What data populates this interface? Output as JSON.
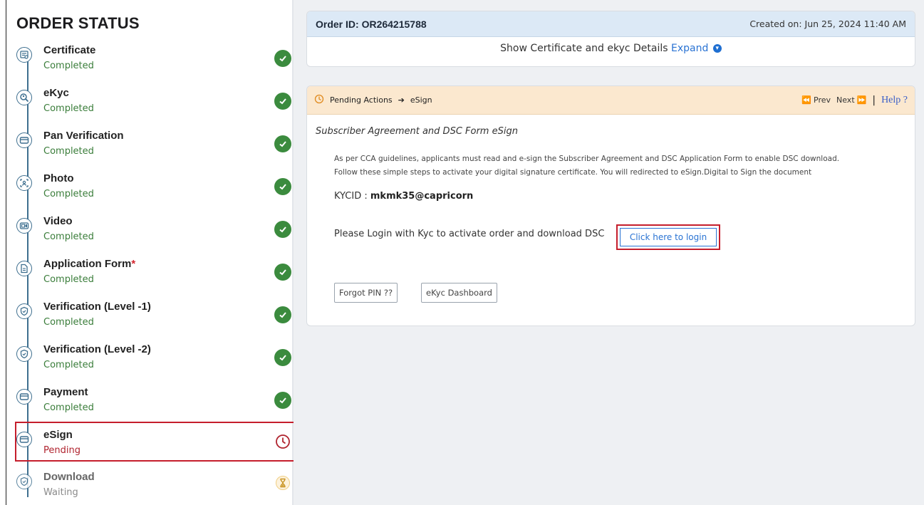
{
  "sidebar": {
    "title": "ORDER STATUS",
    "steps": [
      {
        "label": "Certificate",
        "status": "Completed",
        "icon": "certificate-icon"
      },
      {
        "label": "eKyc",
        "status": "Completed",
        "icon": "ekyc-search-icon"
      },
      {
        "label": "Pan Verification",
        "status": "Completed",
        "icon": "card-icon"
      },
      {
        "label": "Photo",
        "status": "Completed",
        "icon": "photo-icon"
      },
      {
        "label": "Video",
        "status": "Completed",
        "icon": "video-icon"
      },
      {
        "label": "Application Form",
        "status": "Completed",
        "icon": "document-icon",
        "required_mark": "*"
      },
      {
        "label": "Verification (Level -1)",
        "status": "Completed",
        "icon": "shield-icon"
      },
      {
        "label": "Verification (Level -2)",
        "status": "Completed",
        "icon": "shield-icon"
      },
      {
        "label": "Payment",
        "status": "Completed",
        "icon": "card-icon"
      },
      {
        "label": "eSign",
        "status": "Pending",
        "icon": "card-icon"
      },
      {
        "label": "Download",
        "status": "Waiting",
        "icon": "shield-icon"
      }
    ]
  },
  "order": {
    "id_label": "Order ID: OR264215788",
    "created": "Created on: Jun 25, 2024 11:40 AM",
    "expand_text": "Show Certificate and ekyc Details",
    "expand_link": "Expand"
  },
  "action": {
    "breadcrumb_prefix": "Pending Actions",
    "breadcrumb_arrow": "➔",
    "breadcrumb_current": "eSign",
    "prev": "Prev",
    "next": "Next",
    "separator": "|",
    "help": "Help ?",
    "subheading": "Subscriber Agreement and DSC Form eSign",
    "description_line1": "As per CCA guidelines, applicants must read and e-sign the Subscriber Agreement and DSC Application Form to enable DSC download.",
    "description_line2": "Follow these simple steps to activate your digital signature certificate. You will redirected to eSign.Digital to Sign the document",
    "kycid_label": "KYCID :",
    "kycid_value": "mkmk35@capricorn",
    "login_prompt": "Please Login with Kyc to activate order and download DSC",
    "login_button": "Click here to login",
    "forgot_pin": "Forgot PIN ??",
    "ekyc_dashboard": "eKyc Dashboard"
  },
  "colors": {
    "completed_green": "#3b8b3e",
    "pending_red": "#b0242f",
    "highlight_red": "#c51e2c",
    "link_blue": "#2a73d3",
    "order_header_bg": "#dce9f6",
    "action_header_bg": "#fbe8cf",
    "timeline": "#3e6f8f"
  }
}
